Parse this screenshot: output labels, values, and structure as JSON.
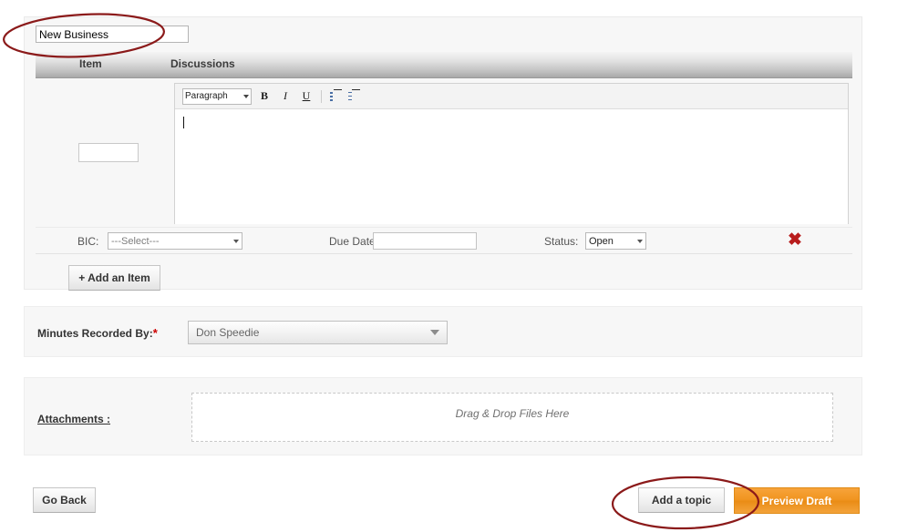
{
  "topic": {
    "title_value": "New Business",
    "title_placeholder": "",
    "columns": {
      "item": "Item",
      "discussions": "Discussions"
    },
    "item_value": "",
    "item_placeholder": "",
    "editor": {
      "paragraph_style": "Paragraph",
      "bold_label": "B",
      "italic_label": "I",
      "underline_label": "U",
      "bullet_list_name": "unordered-list-icon",
      "number_list_name": "ordered-list-icon",
      "content": ""
    },
    "meta": {
      "bic_label": "BIC:",
      "bic_value": "---Select---",
      "due_date_label": "Due Date:",
      "due_date_value": "",
      "status_label": "Status:",
      "status_value": "Open",
      "delete_glyph": "✖"
    },
    "add_item_label": "+ Add an Item"
  },
  "minutes": {
    "label": "Minutes Recorded By:",
    "required_mark": "*",
    "value": "Don Speedie"
  },
  "attachments": {
    "label": "Attachments :",
    "dropzone_text": "Drag & Drop Files Here"
  },
  "footer": {
    "go_back_label": "Go Back",
    "add_topic_label": "Add a topic",
    "preview_label": "Preview Draft"
  },
  "annotations": {
    "color": "#8B1A1A",
    "ellipse_top_target": "New Business title field",
    "ellipse_bottom_target": "Add a topic button"
  },
  "colors": {
    "page_background": "#ffffff",
    "panel_background": "#f7f7f7",
    "header_gradient_start": "#f4f4f4",
    "header_gradient_end": "#a8a8a8",
    "accent_orange": "#f0941f",
    "delete_red": "#b81c1c",
    "required_red": "#cc0000"
  }
}
